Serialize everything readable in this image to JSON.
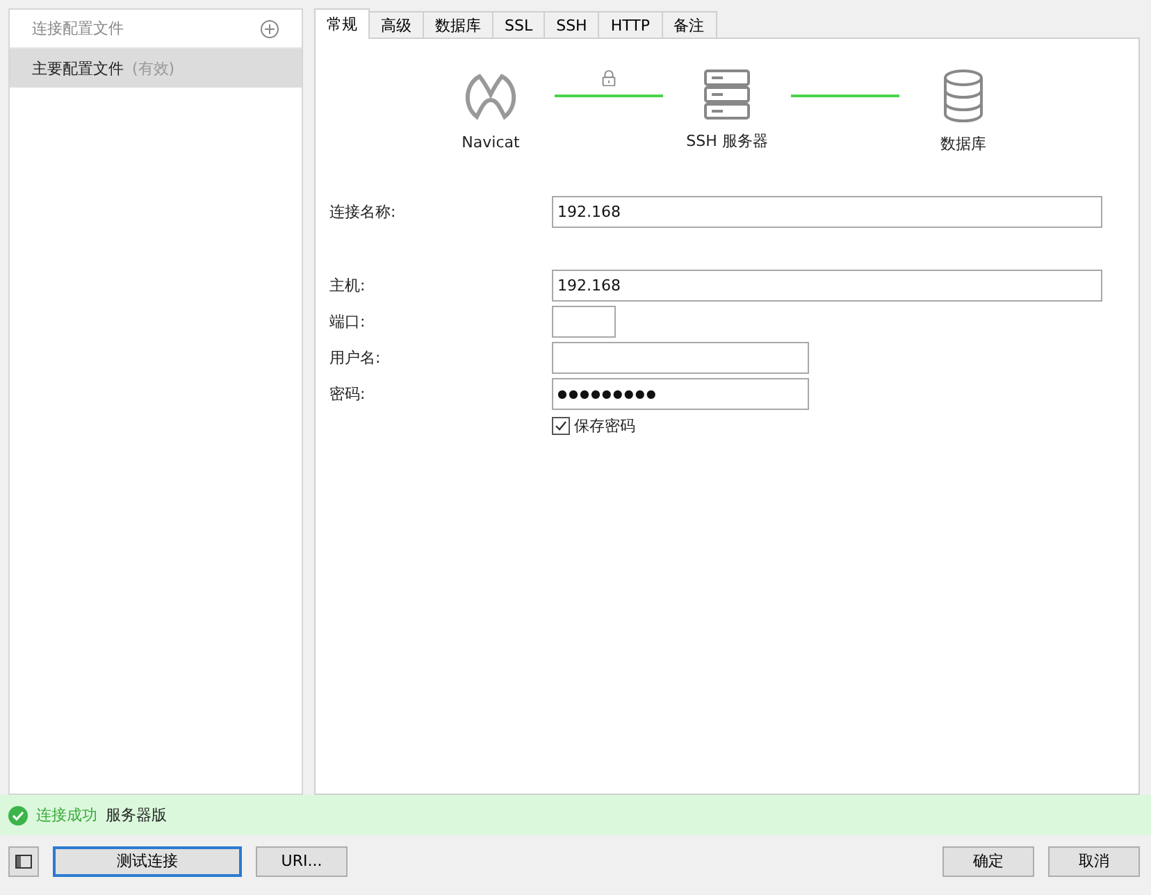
{
  "sidebar": {
    "header": "连接配置文件",
    "items": [
      {
        "label": "主要配置文件",
        "note": "(有效)",
        "selected": true
      }
    ]
  },
  "tabs": [
    {
      "label": "常规",
      "selected": true
    },
    {
      "label": "高级",
      "selected": false
    },
    {
      "label": "数据库",
      "selected": false
    },
    {
      "label": "SSL",
      "selected": false
    },
    {
      "label": "SSH",
      "selected": false
    },
    {
      "label": "HTTP",
      "selected": false
    },
    {
      "label": "备注",
      "selected": false
    }
  ],
  "diagram": {
    "nodes": [
      {
        "kind": "navicat",
        "label": "Navicat"
      },
      {
        "kind": "server",
        "label": "SSH 服务器"
      },
      {
        "kind": "database",
        "label": "数据库"
      }
    ],
    "links": [
      {
        "locked": true
      },
      {
        "locked": false
      }
    ]
  },
  "form": {
    "name_field": {
      "label": "连接名称:",
      "value": "192.168"
    },
    "fields": [
      {
        "kind": "wide",
        "label": "主机:",
        "value": "192.168"
      },
      {
        "kind": "tiny",
        "label": "端口:"
      },
      {
        "kind": "medium",
        "label": "用户名:"
      },
      {
        "kind": "secret",
        "label": "密码:",
        "value": "●●●●●●●●●"
      }
    ],
    "save_password": {
      "label": "保存密码",
      "checked": true
    }
  },
  "status": {
    "message": "连接成功",
    "detail": "服务器版"
  },
  "buttons": {
    "left": [
      "测试连接",
      "URI..."
    ],
    "right": [
      "确定",
      "取消"
    ]
  }
}
